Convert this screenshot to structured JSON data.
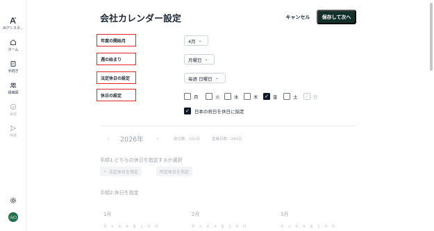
{
  "sidebar": {
    "app": {
      "label": "AIアシスタ...",
      "icon": "ai-logo-icon"
    },
    "items": [
      {
        "label": "ホーム",
        "icon": "home-icon",
        "muted": false
      },
      {
        "label": "手続き",
        "icon": "procedure-icon",
        "muted": false
      },
      {
        "label": "組織図",
        "icon": "org-chart-icon",
        "muted": false
      },
      {
        "label": "承認",
        "icon": "approval-icon",
        "muted": true
      },
      {
        "label": "申請",
        "icon": "send-icon",
        "muted": true
      }
    ],
    "settings_icon": "gear-icon",
    "avatar_text": "山口"
  },
  "header": {
    "title": "会社カレンダー設定",
    "cancel_label": "キャンセル",
    "save_label": "保存して次へ"
  },
  "settings": {
    "fiscal_start": {
      "label": "年度の開始月",
      "value": "4月"
    },
    "week_start": {
      "label": "週の始まり",
      "value": "月曜日"
    },
    "legal_holiday": {
      "label": "法定休日の設定",
      "value": "毎週 日曜日"
    },
    "holidays": {
      "label": "休日の設定"
    }
  },
  "weekdays": [
    {
      "label": "月",
      "checked": false,
      "disabled": false
    },
    {
      "label": "火",
      "checked": false,
      "disabled": false
    },
    {
      "label": "水",
      "checked": false,
      "disabled": false
    },
    {
      "label": "木",
      "checked": false,
      "disabled": false
    },
    {
      "label": "金",
      "checked": true,
      "disabled": false
    },
    {
      "label": "土",
      "checked": false,
      "disabled": false
    },
    {
      "label": "日",
      "checked": true,
      "disabled": true
    }
  ],
  "national_holiday": {
    "label": "日本の祝日を休日に指定",
    "checked": true
  },
  "year_nav": {
    "year": "2026年",
    "holidays_count": "休日数：101日",
    "workdays_count": "営業日数：264日"
  },
  "steps": {
    "step1": "手順1.どちらの休日を指定するか選択",
    "tab_legal": "法定休日を指定",
    "tab_scheduled": "所定休日を指定",
    "step2": "手順2.休日を指定"
  },
  "months": [
    "1月",
    "2月",
    "3月"
  ],
  "dow_labels": [
    "月",
    "火",
    "水",
    "木",
    "金",
    "土",
    "日"
  ],
  "colors": {
    "accent": "#14302a",
    "highlight_border": "#e02424"
  }
}
